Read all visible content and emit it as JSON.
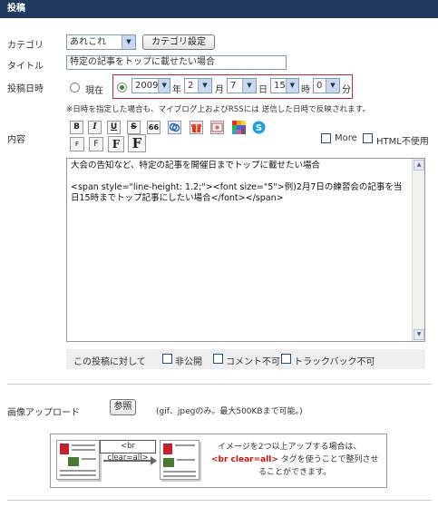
{
  "header": {
    "title": "投稿"
  },
  "category": {
    "label": "カテゴリ",
    "selected": "あれこれ",
    "settings_button": "カテゴリ設定"
  },
  "title_field": {
    "label": "タイトル",
    "value": "特定の記事をトップに載せたい場合"
  },
  "post_date": {
    "label": "投稿日時",
    "now_label": "現在",
    "year": "2009",
    "year_unit": "年",
    "month": "2",
    "month_unit": "月",
    "day": "7",
    "day_unit": "日",
    "hour": "15",
    "hour_unit": "時",
    "minute": "0",
    "minute_unit": "分",
    "note": "※日時を指定した場合も、マイブログ上およびRSSには 送信した日時で反映されます。"
  },
  "content": {
    "label": "内容",
    "more_label": "More",
    "html_off_label": "HTML不使用",
    "toolbar": [
      "B",
      "I",
      "U",
      "S",
      "66"
    ],
    "font_sizes": [
      "F",
      "F",
      "F",
      "F"
    ],
    "body_line1": "大会の告知など、特定の記事を開催日までトップに載せたい場合",
    "body_line2": "<span style=\"line-height: 1.2;\"><font size=\"5\">例)2月7日の練習会の記事を当日15時までトップ記事にしたい場合</font></span>"
  },
  "options": {
    "label": "この投稿に対して",
    "private_label": "非公開",
    "no_comment_label": "コメント不可",
    "no_trackback_label": "トラックバック不可"
  },
  "upload": {
    "label": "画像アップロード",
    "ref_button": "参照",
    "note": "(gif、jpegのみ。最大500KBまで可能。)",
    "hint_tag": "<br clear=all>",
    "hint_line1": "イメージを2つ以上アップする場合は、",
    "hint_line2_tag": "<br clear=all>",
    "hint_line2_rest": " タグを使うことで整列させ",
    "hint_line3": "ることができます。"
  },
  "colors": {
    "header_bg": "#1f3a5c",
    "date_border": "#cc2a2a",
    "radio_on": "#2a8a2a",
    "tag_red": "#cc1111"
  }
}
